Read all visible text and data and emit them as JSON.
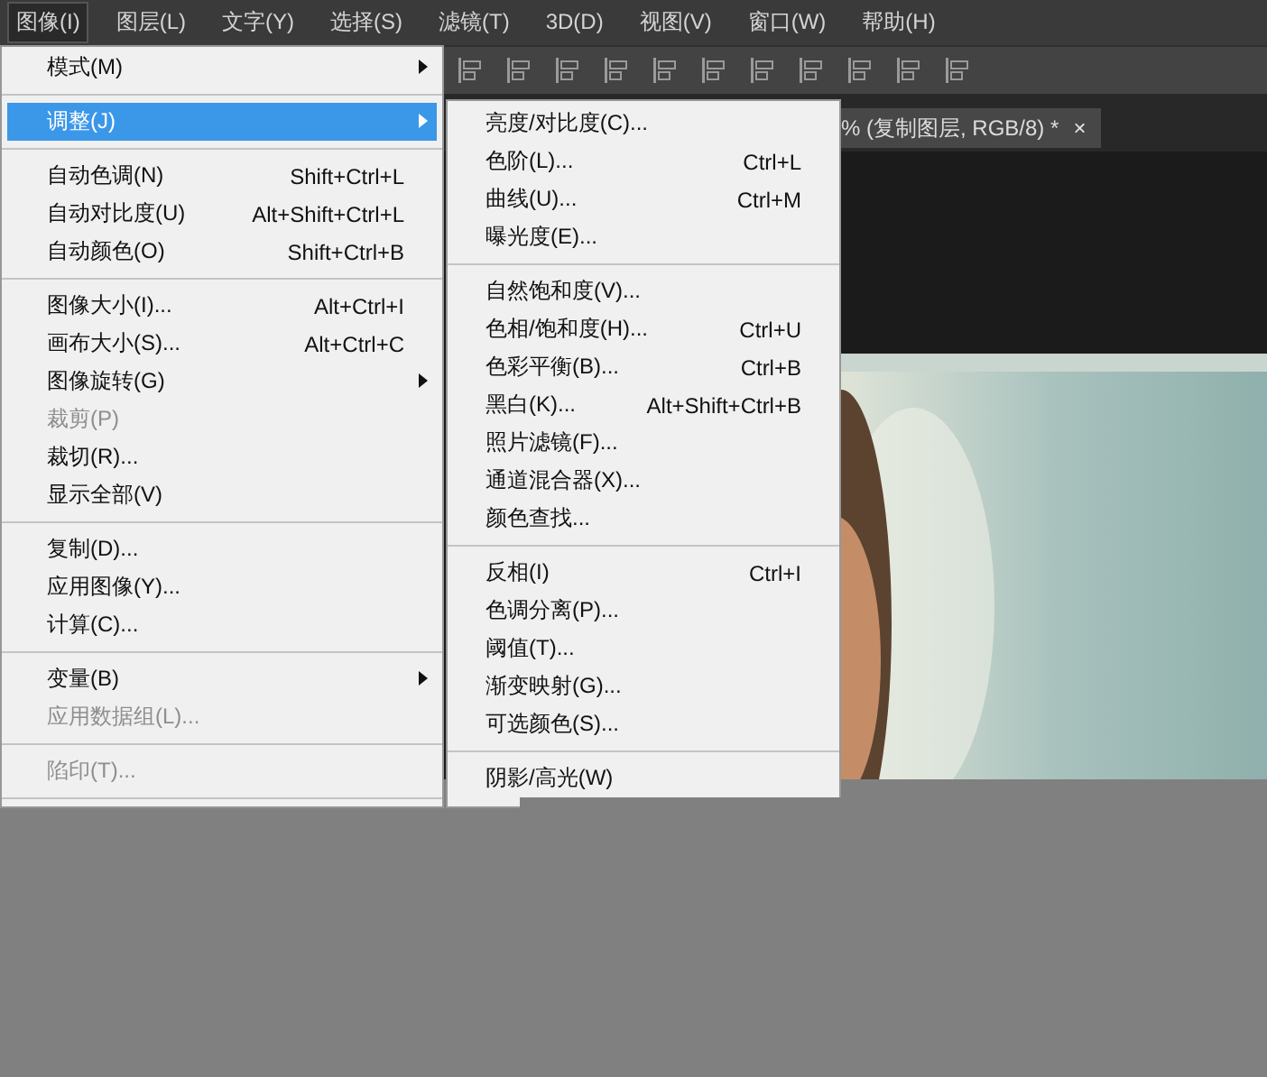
{
  "menubar": [
    {
      "label": "图像(I)",
      "selected": true
    },
    {
      "label": "图层(L)",
      "selected": false
    },
    {
      "label": "文字(Y)",
      "selected": false
    },
    {
      "label": "选择(S)",
      "selected": false
    },
    {
      "label": "滤镜(T)",
      "selected": false
    },
    {
      "label": "3D(D)",
      "selected": false
    },
    {
      "label": "视图(V)",
      "selected": false
    },
    {
      "label": "窗口(W)",
      "selected": false
    },
    {
      "label": "帮助(H)",
      "selected": false
    }
  ],
  "document_tab": {
    "title": "% (复制图层, RGB/8) *",
    "close": "×"
  },
  "image_menu": [
    {
      "kind": "item",
      "label": "模式(M)",
      "submenu": true,
      "disabled": false,
      "selected": false
    },
    {
      "kind": "separator"
    },
    {
      "kind": "item",
      "label": "调整(J)",
      "submenu": true,
      "disabled": false,
      "selected": true
    },
    {
      "kind": "separator"
    },
    {
      "kind": "item",
      "label": "自动色调(N)",
      "shortcut": "Shift+Ctrl+L",
      "submenu": false,
      "disabled": false,
      "selected": false
    },
    {
      "kind": "item",
      "label": "自动对比度(U)",
      "shortcut": "Alt+Shift+Ctrl+L",
      "submenu": false,
      "disabled": false,
      "selected": false
    },
    {
      "kind": "item",
      "label": "自动颜色(O)",
      "shortcut": "Shift+Ctrl+B",
      "submenu": false,
      "disabled": false,
      "selected": false
    },
    {
      "kind": "separator"
    },
    {
      "kind": "item",
      "label": "图像大小(I)...",
      "shortcut": "Alt+Ctrl+I",
      "submenu": false,
      "disabled": false,
      "selected": false
    },
    {
      "kind": "item",
      "label": "画布大小(S)...",
      "shortcut": "Alt+Ctrl+C",
      "submenu": false,
      "disabled": false,
      "selected": false
    },
    {
      "kind": "item",
      "label": "图像旋转(G)",
      "submenu": true,
      "disabled": false,
      "selected": false
    },
    {
      "kind": "item",
      "label": "裁剪(P)",
      "submenu": false,
      "disabled": true,
      "selected": false
    },
    {
      "kind": "item",
      "label": "裁切(R)...",
      "submenu": false,
      "disabled": false,
      "selected": false
    },
    {
      "kind": "item",
      "label": "显示全部(V)",
      "submenu": false,
      "disabled": false,
      "selected": false
    },
    {
      "kind": "separator"
    },
    {
      "kind": "item",
      "label": "复制(D)...",
      "submenu": false,
      "disabled": false,
      "selected": false
    },
    {
      "kind": "item",
      "label": "应用图像(Y)...",
      "submenu": false,
      "disabled": false,
      "selected": false
    },
    {
      "kind": "item",
      "label": "计算(C)...",
      "submenu": false,
      "disabled": false,
      "selected": false
    },
    {
      "kind": "separator"
    },
    {
      "kind": "item",
      "label": "变量(B)",
      "submenu": true,
      "disabled": false,
      "selected": false
    },
    {
      "kind": "item",
      "label": "应用数据组(L)...",
      "submenu": false,
      "disabled": true,
      "selected": false
    },
    {
      "kind": "separator"
    },
    {
      "kind": "item",
      "label": "陷印(T)...",
      "submenu": false,
      "disabled": true,
      "selected": false
    },
    {
      "kind": "separator"
    }
  ],
  "adjust_submenu": [
    {
      "kind": "item",
      "label": "亮度/对比度(C)...",
      "disabled": false
    },
    {
      "kind": "item",
      "label": "色阶(L)...",
      "shortcut": "Ctrl+L",
      "disabled": false
    },
    {
      "kind": "item",
      "label": "曲线(U)...",
      "shortcut": "Ctrl+M",
      "disabled": false
    },
    {
      "kind": "item",
      "label": "曝光度(E)...",
      "disabled": false
    },
    {
      "kind": "separator"
    },
    {
      "kind": "item",
      "label": "自然饱和度(V)...",
      "disabled": false
    },
    {
      "kind": "item",
      "label": "色相/饱和度(H)...",
      "shortcut": "Ctrl+U",
      "disabled": false
    },
    {
      "kind": "item",
      "label": "色彩平衡(B)...",
      "shortcut": "Ctrl+B",
      "disabled": false
    },
    {
      "kind": "item",
      "label": "黑白(K)...",
      "shortcut": "Alt+Shift+Ctrl+B",
      "disabled": false
    },
    {
      "kind": "item",
      "label": "照片滤镜(F)...",
      "disabled": false
    },
    {
      "kind": "item",
      "label": "通道混合器(X)...",
      "disabled": false
    },
    {
      "kind": "item",
      "label": "颜色查找...",
      "disabled": false
    },
    {
      "kind": "separator"
    },
    {
      "kind": "item",
      "label": "反相(I)",
      "shortcut": "Ctrl+I",
      "disabled": false
    },
    {
      "kind": "item",
      "label": "色调分离(P)...",
      "disabled": false
    },
    {
      "kind": "item",
      "label": "阈值(T)...",
      "disabled": false
    },
    {
      "kind": "item",
      "label": "渐变映射(G)...",
      "disabled": false
    },
    {
      "kind": "item",
      "label": "可选颜色(S)...",
      "disabled": false
    },
    {
      "kind": "separator"
    },
    {
      "kind": "item",
      "label": "阴影/高光(W)",
      "disabled": false
    }
  ]
}
